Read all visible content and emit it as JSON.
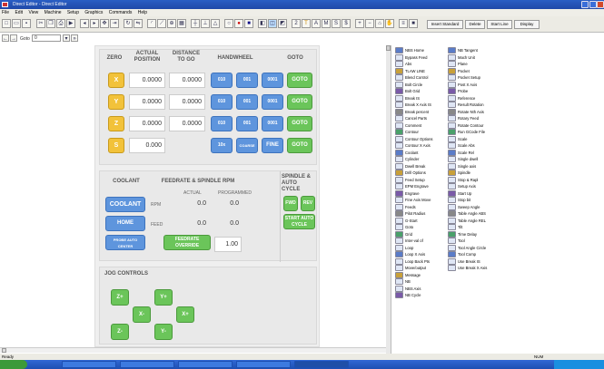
{
  "window": {
    "title": "Direct Editor - Direct Editor"
  },
  "menu": [
    "File",
    "Edit",
    "View",
    "Machine",
    "Setup",
    "Graphics",
    "Commands",
    "Help"
  ],
  "toolbar": {
    "insert_standard": "Insert Standard",
    "delete": "Delete",
    "start_line": "Start Line",
    "display": "Display"
  },
  "toolbar2": {
    "goto_label": "Goto",
    "goto_value": "0"
  },
  "position": {
    "headers": {
      "zero": "ZERO",
      "actual": "ACTUAL POSITION",
      "dtg": "DISTANCE TO GO",
      "handwheel": "HANDWHEEL",
      "goto": "GOTO"
    },
    "axes": [
      {
        "axis": "X",
        "actual": "0.0000",
        "dtg": "0.0000",
        "h1": "010",
        "h2": "001",
        "h3": "0001",
        "goto": "GOTO"
      },
      {
        "axis": "Y",
        "actual": "0.0000",
        "dtg": "0.0000",
        "h1": "010",
        "h2": "001",
        "h3": "0001",
        "goto": "GOTO"
      },
      {
        "axis": "Z",
        "actual": "0.0000",
        "dtg": "0.0000",
        "h1": "010",
        "h2": "001",
        "h3": "0001",
        "goto": "GOTO"
      },
      {
        "axis": "S",
        "actual": "0.000",
        "dtg": "",
        "h1": "10x",
        "h2": "COARSE",
        "h3": "FINE",
        "goto": "GOTO"
      }
    ]
  },
  "feed": {
    "coolant_header": "COOLANT",
    "feed_header": "FEEDRATE & SPINDLE RPM",
    "spindle_header": "SPINDLE & AUTO CYCLE",
    "actual": "ACTUAL",
    "programmed": "PROGRAMMED",
    "coolant_btn": "COOLANT",
    "home_btn": "HOME",
    "probe_btn": "PROBE AUTO CENTER",
    "rpm_label": "RPM",
    "feed_label": "FEED",
    "rpm_actual": "0.0",
    "rpm_prog": "0.0",
    "feed_actual": "0.0",
    "feed_prog": "0.0",
    "override_btn": "FEEDRATE OVERRIDE",
    "override_val": "1.00",
    "fwd": "FWD",
    "rev": "REV",
    "start_auto": "START AUTO CYCLE"
  },
  "jog": {
    "header": "JOG CONTROLS",
    "zplus": "Z+",
    "yplus": "Y+",
    "xminus": "X-",
    "xplus": "X+",
    "zminus": "Z-",
    "yminus": "Y-"
  },
  "commands": {
    "col1": [
      "NBS Home",
      "Bypass Feed",
      "Abs",
      "TLAW LINE",
      "Blend Control",
      "Bolt Circle",
      "Bolt Grid",
      "Break IS",
      "Break X Axis IS",
      "Break percent",
      "Cancel Parts",
      "Comment",
      "Contour",
      "Contour Options",
      "Contour X Axis",
      "Coolant",
      "Cylinder",
      "Dwell Break",
      "Drill Options",
      "Feed Setup",
      "EPM Engrave",
      "Engrave",
      "Fine Axis Move",
      "Feeds",
      "Pilot Radius",
      "G-Start",
      "Goto",
      "Grid",
      "Inter-val of",
      "Loop",
      "Loop X Axis",
      "Loop Back Pts",
      "Move/output",
      "Message",
      "NB",
      "NBS Axis",
      "NB Cycle"
    ],
    "col2": [
      "NB Tangent",
      "Mach Unit",
      "Plane",
      "Pocket",
      "Pocket Setup",
      "Post X Axis",
      "Probe",
      "Reference",
      "Result Rotation",
      "Rotate Nth Axis",
      "Rotary Feed",
      "Rotate Contour",
      "Run GCode File",
      "Scale",
      "Scale Abs",
      "Scale Rel",
      "Single dwell",
      "Single axis",
      "Spindle",
      "Stop & Rapl",
      "Setup Axis",
      "Start Up",
      "Stop bit",
      "Sweep Angle",
      "Table Angle ABS",
      "Table Angle REL",
      "Tilt",
      "Time Delay",
      "Tool",
      "Tool Angle Circle",
      "Tool Comp",
      "Use Break IS",
      "Use Break X Axis"
    ]
  },
  "status": {
    "left": "Ready",
    "right": "NUM"
  }
}
